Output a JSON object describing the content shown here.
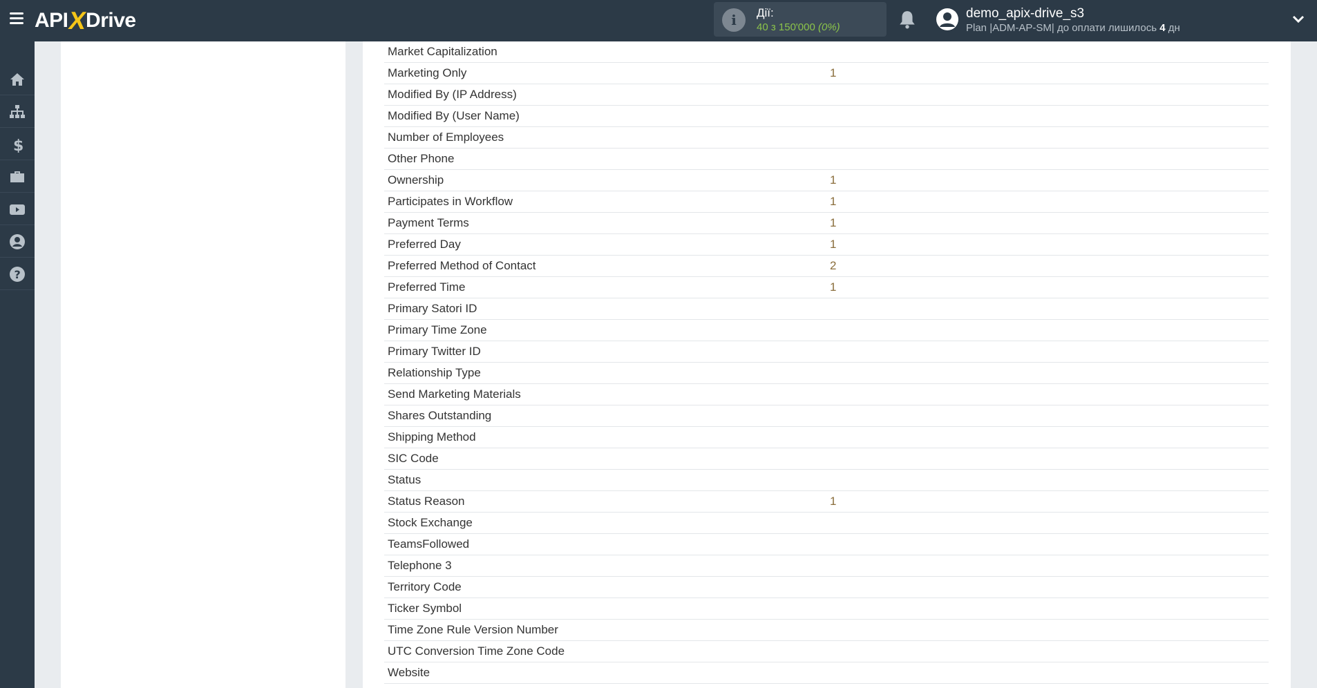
{
  "header": {
    "logo_left": "API",
    "logo_x": "X",
    "logo_right": "Drive",
    "actions_label": "Дії:",
    "actions_value": "40 з 150'000",
    "actions_percent": "(0%)",
    "user_name": "demo_apix-drive_s3",
    "plan_text": "Plan |ADM-AP-SM| до оплати лишилось",
    "plan_days": "4",
    "plan_unit": "дн"
  },
  "sidebar": {
    "items": [
      "home-icon",
      "sitemap-icon",
      "dollar-icon",
      "briefcase-icon",
      "video-icon",
      "user-icon",
      "help-icon"
    ]
  },
  "fields": [
    {
      "name": "Market Capitalization",
      "value": ""
    },
    {
      "name": "Marketing Only",
      "value": "1"
    },
    {
      "name": "Modified By (IP Address)",
      "value": ""
    },
    {
      "name": "Modified By (User Name)",
      "value": ""
    },
    {
      "name": "Number of Employees",
      "value": ""
    },
    {
      "name": "Other Phone",
      "value": ""
    },
    {
      "name": "Ownership",
      "value": "1"
    },
    {
      "name": "Participates in Workflow",
      "value": "1"
    },
    {
      "name": "Payment Terms",
      "value": "1"
    },
    {
      "name": "Preferred Day",
      "value": "1"
    },
    {
      "name": "Preferred Method of Contact",
      "value": "2"
    },
    {
      "name": "Preferred Time",
      "value": "1"
    },
    {
      "name": "Primary Satori ID",
      "value": ""
    },
    {
      "name": "Primary Time Zone",
      "value": ""
    },
    {
      "name": "Primary Twitter ID",
      "value": ""
    },
    {
      "name": "Relationship Type",
      "value": ""
    },
    {
      "name": "Send Marketing Materials",
      "value": ""
    },
    {
      "name": "Shares Outstanding",
      "value": ""
    },
    {
      "name": "Shipping Method",
      "value": ""
    },
    {
      "name": "SIC Code",
      "value": ""
    },
    {
      "name": "Status",
      "value": ""
    },
    {
      "name": "Status Reason",
      "value": "1"
    },
    {
      "name": "Stock Exchange",
      "value": ""
    },
    {
      "name": "TeamsFollowed",
      "value": ""
    },
    {
      "name": "Telephone 3",
      "value": ""
    },
    {
      "name": "Territory Code",
      "value": ""
    },
    {
      "name": "Ticker Symbol",
      "value": ""
    },
    {
      "name": "Time Zone Rule Version Number",
      "value": ""
    },
    {
      "name": "UTC Conversion Time Zone Code",
      "value": ""
    },
    {
      "name": "Website",
      "value": ""
    }
  ]
}
